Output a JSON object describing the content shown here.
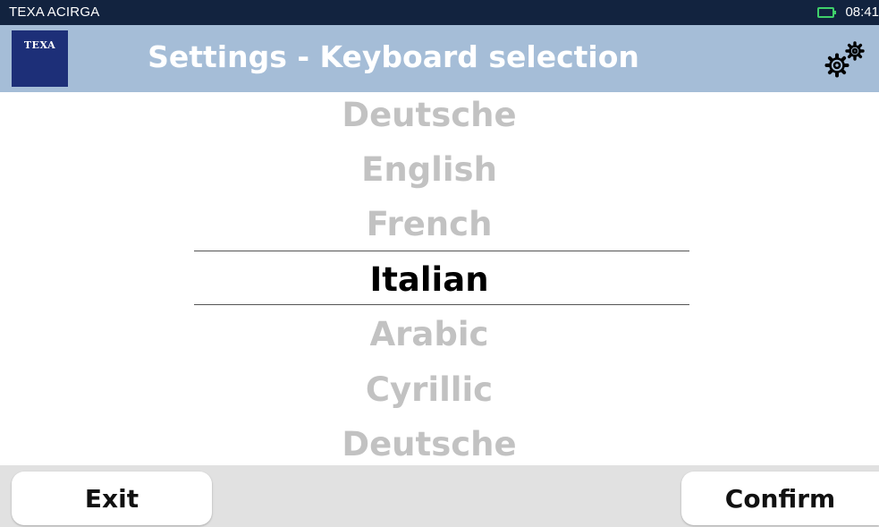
{
  "status_bar": {
    "device_name": "TEXA ACIRGA",
    "time": "08:41",
    "battery_icon": "battery-icon"
  },
  "header": {
    "logo_text": "TEXA",
    "title": "Settings - Keyboard selection",
    "settings_icon": "gears-icon"
  },
  "picker": {
    "items": [
      "Deutsche",
      "English",
      "French",
      "Italian",
      "Arabic",
      "Cyrillic",
      "Deutsche"
    ],
    "selected": "Italian"
  },
  "footer": {
    "exit_label": "Exit",
    "confirm_label": "Confirm"
  },
  "colors": {
    "status_bar_bg": "#12233f",
    "title_bar_bg": "#a5bdd7",
    "logo_bg": "#1d2f78",
    "battery": "#3fd06a",
    "unselected_text": "#c2c2c2",
    "selected_text": "#000000",
    "footer_bg": "#e1e1e1"
  }
}
